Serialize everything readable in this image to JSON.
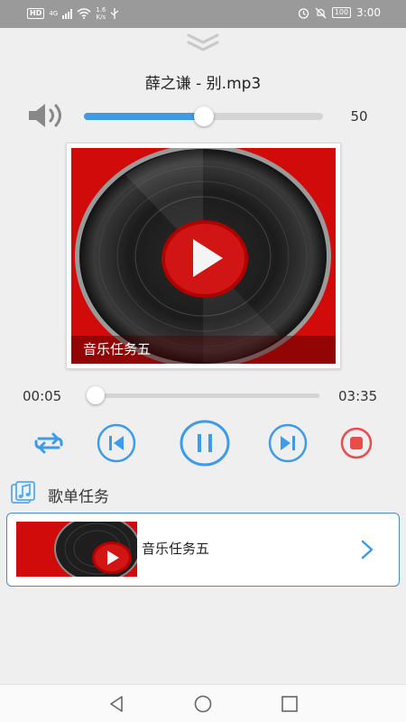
{
  "status_bar": {
    "network_badge": "HD",
    "signal_type": "4G",
    "speed_value": "1.6",
    "speed_unit": "K/s",
    "battery": "100",
    "time": "3:00"
  },
  "player": {
    "song_title": "薛之谦 - 别.mp3",
    "volume": {
      "value_label": "50",
      "level_fraction": 0.5
    },
    "album": {
      "caption": "音乐任务五"
    },
    "progress": {
      "current": "00:05",
      "total": "03:35",
      "fraction": 0.023
    }
  },
  "icons": {
    "collapse": "chevron-double-down-icon",
    "volume": "speaker-icon",
    "repeat": "repeat-icon",
    "previous": "skip-previous-icon",
    "pause": "pause-icon",
    "next": "skip-next-icon",
    "stop": "stop-icon",
    "playlist": "music-note-icon",
    "arrow": "chevron-right-icon"
  },
  "playlist": {
    "title": "歌单任务",
    "items": [
      {
        "label": "音乐任务五"
      }
    ]
  },
  "colors": {
    "accent": "#3d9be9",
    "stop_red": "#ea4b4b",
    "album_red": "#d10a0a"
  }
}
